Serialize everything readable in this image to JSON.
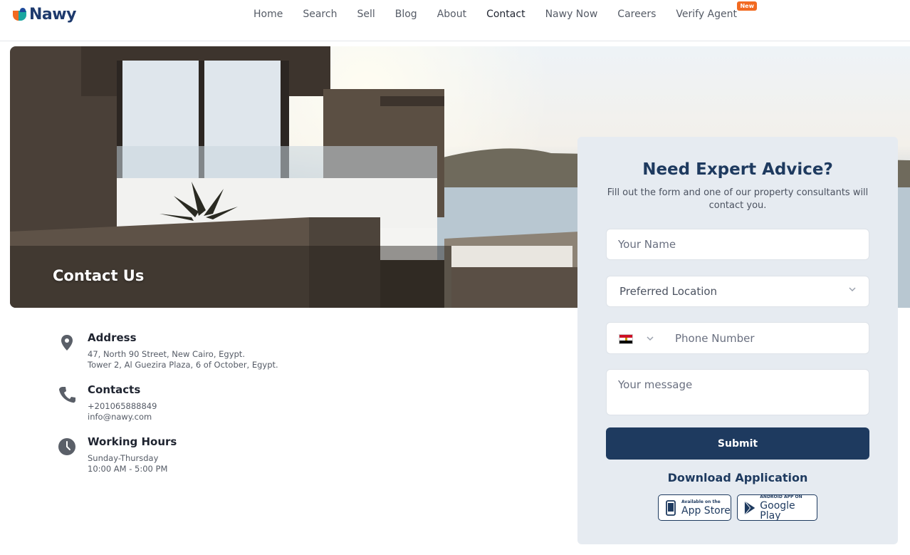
{
  "brand": {
    "name": "Nawy"
  },
  "nav": {
    "items": [
      {
        "label": "Home"
      },
      {
        "label": "Search"
      },
      {
        "label": "Sell"
      },
      {
        "label": "Blog"
      },
      {
        "label": "About"
      },
      {
        "label": "Contact",
        "active": true
      },
      {
        "label": "Nawy Now"
      },
      {
        "label": "Careers"
      },
      {
        "label": "Verify Agent",
        "badge": "New"
      }
    ]
  },
  "hero": {
    "title": "Contact Us"
  },
  "contact_info": {
    "address": {
      "title": "Address",
      "lines": [
        "47, North 90 Street, New Cairo, Egypt.",
        "Tower 2, Al Guezira Plaza, 6 of October, Egypt."
      ]
    },
    "contacts": {
      "title": "Contacts",
      "lines": [
        "+201065888849",
        "info@nawy.com"
      ]
    },
    "hours": {
      "title": "Working Hours",
      "lines": [
        "Sunday-Thursday",
        "10:00 AM - 5:00 PM"
      ]
    }
  },
  "form": {
    "title": "Need Expert Advice?",
    "subtitle": "Fill out the form and one of our property consultants will contact you.",
    "name_placeholder": "Your Name",
    "location_placeholder": "Preferred Location",
    "phone_placeholder": "Phone Number",
    "message_placeholder": "Your message",
    "submit_label": "Submit",
    "download_title": "Download Application",
    "app_store": {
      "small": "Available on the",
      "big": "App Store"
    },
    "google_play": {
      "small": "ANDROID APP ON",
      "big": "Google Play"
    }
  },
  "colors": {
    "primary": "#1e3a5f",
    "accent": "#f26a21",
    "card_bg": "#e6ebf1"
  },
  "icons": {
    "address": "location-pin-icon",
    "contacts": "phone-icon",
    "hours": "clock-icon",
    "flag": "egypt-flag-icon"
  }
}
